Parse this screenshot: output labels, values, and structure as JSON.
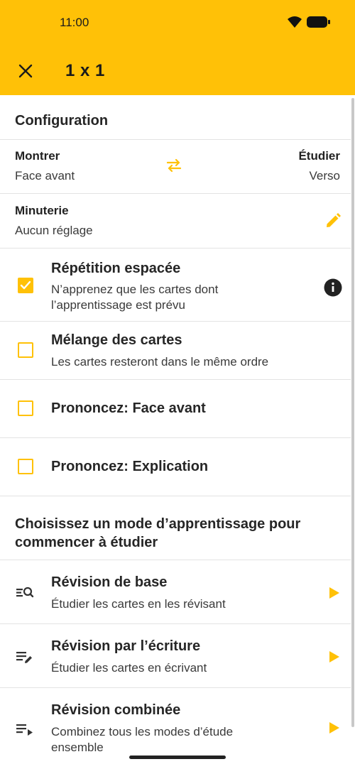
{
  "status_bar": {
    "time": "11:00"
  },
  "app_bar": {
    "title": "1 x 1"
  },
  "configuration": {
    "heading": "Configuration",
    "show": {
      "label": "Montrer",
      "value": "Face avant"
    },
    "study": {
      "label": "Étudier",
      "value": "Verso"
    },
    "timer": {
      "label": "Minuterie",
      "value": "Aucun réglage"
    }
  },
  "options": [
    {
      "title": "Répétition espacée",
      "desc_line1": "N’apprenez que les cartes dont",
      "desc_line2": "l’apprentissage est prévu",
      "checked": true
    },
    {
      "title": "Mélange des cartes",
      "desc_line1": "Les cartes resteront dans le même ordre",
      "checked": false
    },
    {
      "title": "Prononcez: Face avant",
      "checked": false
    },
    {
      "title": "Prononcez: Explication",
      "checked": false
    }
  ],
  "modes": {
    "heading_line1": "Choisissez un mode d’apprentissage pour",
    "heading_line2": "commencer à étudier",
    "items": [
      {
        "title": "Révision de base",
        "desc_line1": "Étudier les cartes en les révisant",
        "icon": "list-search-icon"
      },
      {
        "title": "Révision par l’écriture",
        "desc_line1": "Étudier les cartes en écrivant",
        "icon": "list-edit-icon"
      },
      {
        "title": "Révision combinée",
        "desc_line1": "Combinez tous les modes d’étude",
        "desc_line2": "ensemble",
        "icon": "list-play-icon"
      }
    ]
  },
  "colors": {
    "accent": "#ffc107",
    "text": "#262626",
    "divider": "#e3e3e3"
  }
}
